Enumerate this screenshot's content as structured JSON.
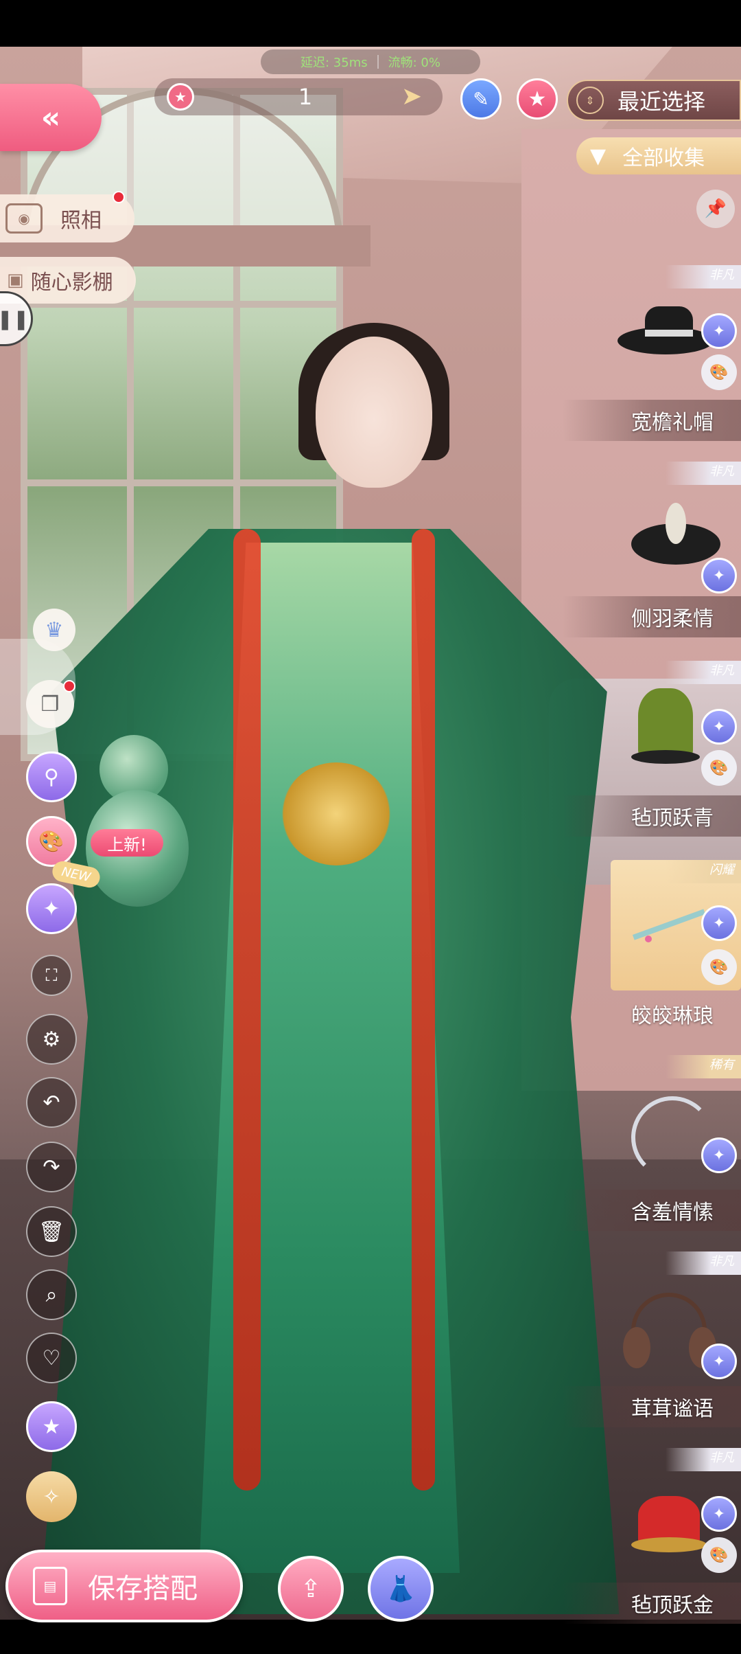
{
  "status": {
    "latency": "延迟: 35ms",
    "second": "流畅: 0%"
  },
  "nav": {
    "back_icon": "«",
    "page_number": "1",
    "next_icon": "➤",
    "recent_label": "最近选择",
    "collection_label": "全部收集"
  },
  "left_tools": {
    "photo_label": "照相",
    "studio_label": "随心影棚",
    "new_badge": "上新!",
    "new_tag": "NEW"
  },
  "items": [
    {
      "name": "宽檐礼帽",
      "tag": "非凡"
    },
    {
      "name": "侧羽柔情",
      "tag": "非凡"
    },
    {
      "name": "毡顶跃青",
      "tag": "非凡"
    },
    {
      "name": "皎皎琳琅",
      "tag": "闪耀"
    },
    {
      "name": "含羞情愫",
      "tag": "稀有"
    },
    {
      "name": "茸茸谧语",
      "tag": "非凡"
    },
    {
      "name": "毡顶跃金",
      "tag": "非凡"
    }
  ],
  "bottom": {
    "save_label": "保存搭配"
  },
  "colors": {
    "accent_pink": "#ef5c80",
    "accent_purple": "#6c72e0",
    "gold": "#e9c48c"
  }
}
